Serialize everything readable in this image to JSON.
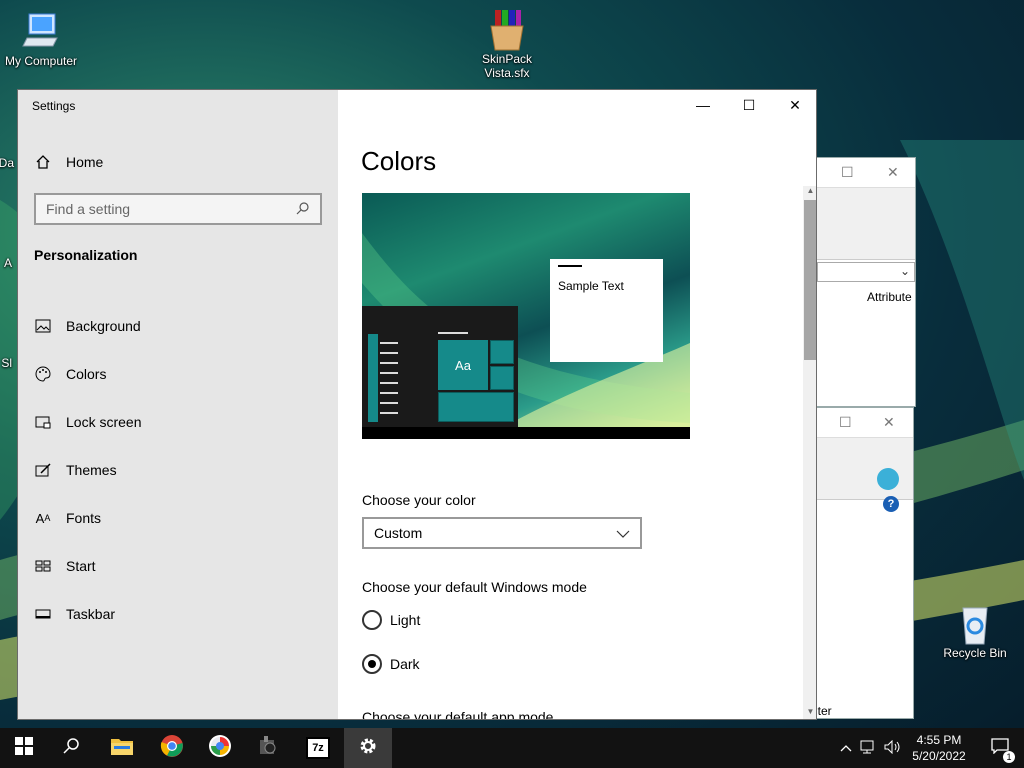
{
  "desktop": {
    "icons": [
      {
        "label": "My Computer"
      },
      {
        "label": "SkinPack Vista.sfx"
      },
      {
        "label": "Recycle Bin"
      }
    ],
    "partial_labels": [
      "Da",
      "A",
      "Sl"
    ]
  },
  "background_windows": {
    "explorer_column_header": "Attribute",
    "explorer_status": "uter"
  },
  "settings": {
    "window_title": "Settings",
    "controls": {
      "minimize": "—",
      "maximize": "☐",
      "close": "✕"
    },
    "sidebar": {
      "home_label": "Home",
      "search_placeholder": "Find a setting",
      "section_title": "Personalization",
      "items": [
        {
          "label": "Background",
          "icon": "picture-icon"
        },
        {
          "label": "Colors",
          "icon": "palette-icon"
        },
        {
          "label": "Lock screen",
          "icon": "lock-screen-icon"
        },
        {
          "label": "Themes",
          "icon": "brush-icon"
        },
        {
          "label": "Fonts",
          "icon": "font-icon"
        },
        {
          "label": "Start",
          "icon": "start-icon"
        },
        {
          "label": "Taskbar",
          "icon": "taskbar-icon"
        }
      ],
      "active_item": "Colors"
    },
    "main": {
      "title": "Colors",
      "preview": {
        "sample_text": "Sample Text",
        "tile_label": "Aa"
      },
      "choose_color_label": "Choose your color",
      "choose_color_value": "Custom",
      "windows_mode_label": "Choose your default Windows mode",
      "windows_mode_options": [
        {
          "label": "Light",
          "selected": false
        },
        {
          "label": "Dark",
          "selected": true
        }
      ],
      "app_mode_label": "Choose your default app mode"
    }
  },
  "taskbar": {
    "apps": [
      "start-icon",
      "search-icon",
      "file-explorer-icon",
      "chrome-icon",
      "brave-icon",
      "media-player-icon",
      "7zip-icon",
      "settings-icon"
    ],
    "active_app": "settings-icon",
    "zip_label": "7z",
    "clock_time": "4:55 PM",
    "clock_date": "5/20/2022",
    "notification_count": "1"
  }
}
